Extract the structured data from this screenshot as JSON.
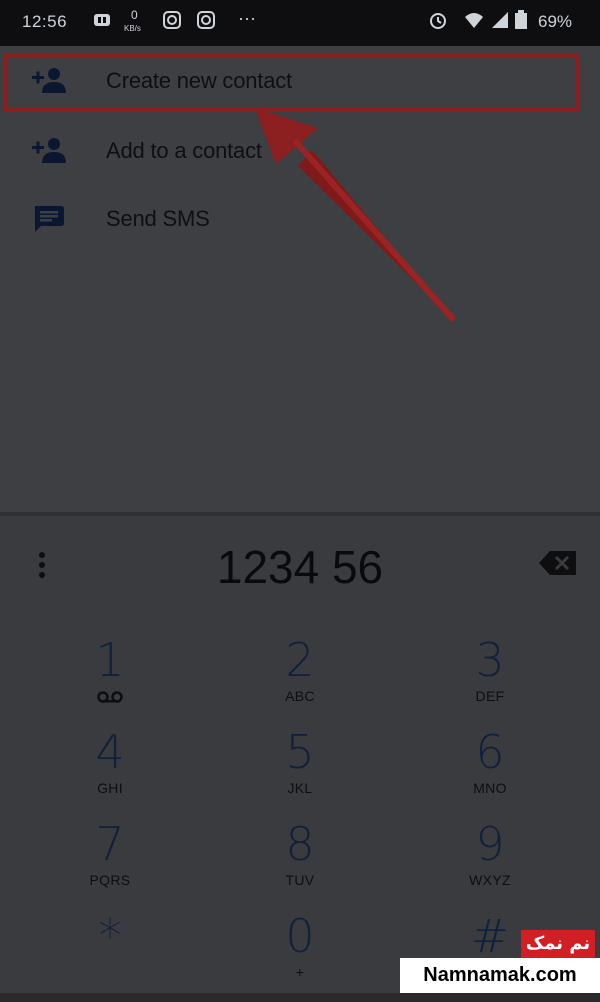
{
  "status_bar": {
    "time": "12:56",
    "network_speed": "0",
    "network_unit": "KB/s",
    "overflow": "···",
    "battery": "69%"
  },
  "actions": [
    {
      "label": "Create new contact",
      "icon": "person-add-icon"
    },
    {
      "label": "Add to a contact",
      "icon": "person-add-icon"
    },
    {
      "label": "Send SMS",
      "icon": "message-icon"
    }
  ],
  "dialer": {
    "number": "1234 56"
  },
  "keypad": [
    {
      "digit": "1",
      "letters": "",
      "icon": "voicemail-icon"
    },
    {
      "digit": "2",
      "letters": "ABC"
    },
    {
      "digit": "3",
      "letters": "DEF"
    },
    {
      "digit": "4",
      "letters": "GHI"
    },
    {
      "digit": "5",
      "letters": "JKL"
    },
    {
      "digit": "6",
      "letters": "MNO"
    },
    {
      "digit": "7",
      "letters": "PQRS"
    },
    {
      "digit": "8",
      "letters": "TUV"
    },
    {
      "digit": "9",
      "letters": "WXYZ"
    },
    {
      "digit": "*",
      "letters": ""
    },
    {
      "digit": "0",
      "letters": "+"
    },
    {
      "digit": "#",
      "letters": ""
    }
  ],
  "watermark": {
    "fa": "نم نمک",
    "en": "Namnamak.com"
  },
  "colors": {
    "highlight": "#8c1f1f",
    "watermark_red": "#d21f26"
  }
}
